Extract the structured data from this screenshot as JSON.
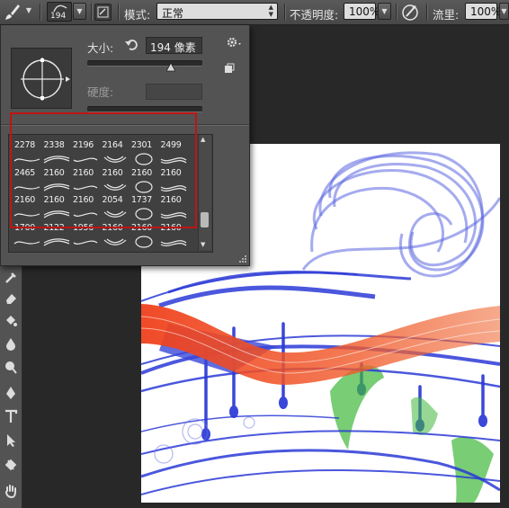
{
  "options_bar": {
    "brush_size_value": "194",
    "mode_label": "模式:",
    "mode_value": "正常",
    "opacity_label": "不透明度:",
    "opacity_value": "100%",
    "flow_label": "流里:",
    "flow_value": "100%"
  },
  "brush_picker": {
    "size_label": "大小:",
    "size_value": "194 像素",
    "size_slider_fraction": 0.73,
    "hardness_label": "硬度:",
    "brush_rows": [
      [
        "2278",
        "2338",
        "2196",
        "2164",
        "2301",
        "2499"
      ],
      [
        "2465",
        "2160",
        "2160",
        "2160",
        "2160",
        "2160"
      ],
      [
        "2160",
        "2160",
        "2160",
        "2054",
        "1737",
        "2160"
      ],
      [
        "1700",
        "2122",
        "1956",
        "2160",
        "2160",
        "2160"
      ]
    ]
  },
  "colors": {
    "panel_bg": "#535353",
    "highlight": "#c01414",
    "brush_blue": "#3a47d8",
    "brush_red": "#f03a1a",
    "brush_green": "#3fb83a"
  }
}
